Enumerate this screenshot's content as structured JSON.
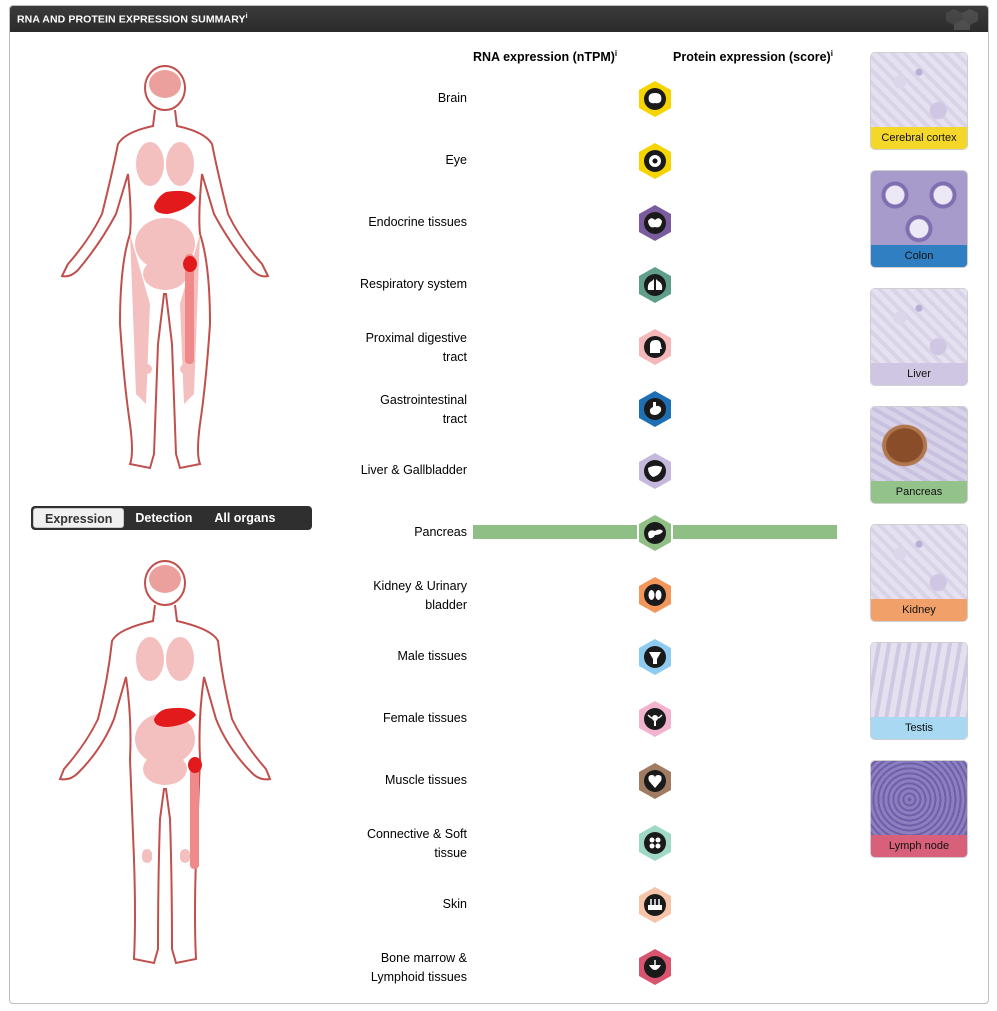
{
  "header": {
    "title": "RNA AND PROTEIN EXPRESSION SUMMARY",
    "info_mark": "i"
  },
  "columns": {
    "rna": "RNA expression (nTPM)",
    "protein": "Protein expression (score)",
    "info_mark": "i"
  },
  "toggle": {
    "items": [
      "Expression",
      "Detection",
      "All organs"
    ],
    "selected": "Expression"
  },
  "tissues": [
    {
      "label": "Brain",
      "color": "#f5d400",
      "icon": "brain-icon"
    },
    {
      "label": "Eye",
      "color": "#f5d400",
      "icon": "eye-icon"
    },
    {
      "label": "Endocrine tissues",
      "color": "#7a5c9e",
      "icon": "thyroid-icon"
    },
    {
      "label": "Respiratory system",
      "color": "#5f9e8a",
      "icon": "lungs-icon"
    },
    {
      "label": "Proximal digestive tract",
      "color": "#f4b8b8",
      "icon": "head-icon"
    },
    {
      "label": "Gastrointestinal tract",
      "color": "#1f6fb5",
      "icon": "stomach-icon"
    },
    {
      "label": "Liver & Gallbladder",
      "color": "#c5b8dc",
      "icon": "liver-icon"
    },
    {
      "label": "Pancreas",
      "color": "#8fbf85",
      "icon": "pancreas-icon"
    },
    {
      "label": "Kidney & Urinary bladder",
      "color": "#f2965a",
      "icon": "kidney-icon"
    },
    {
      "label": "Male tissues",
      "color": "#8ecbf0",
      "icon": "male-icon"
    },
    {
      "label": "Female tissues",
      "color": "#f2b3cf",
      "icon": "female-icon"
    },
    {
      "label": "Muscle tissues",
      "color": "#a07d62",
      "icon": "heart-icon"
    },
    {
      "label": "Connective & Soft tissue",
      "color": "#9fd9c6",
      "icon": "cells-icon"
    },
    {
      "label": "Skin",
      "color": "#f6c4a8",
      "icon": "skin-icon"
    },
    {
      "label": "Bone marrow & Lymphoid tissues",
      "color": "#d9546e",
      "icon": "lymph-icon"
    }
  ],
  "highlight": {
    "tissue": "Pancreas",
    "rna_level": 1.0,
    "protein_level": 1.0,
    "color": "#8fbf85"
  },
  "thumbnails": [
    {
      "label": "Cerebral cortex",
      "color": "#f5d72a"
    },
    {
      "label": "Colon",
      "color": "#2f7fc2"
    },
    {
      "label": "Liver",
      "color": "#cfc6e3"
    },
    {
      "label": "Pancreas",
      "color": "#93c28a"
    },
    {
      "label": "Kidney",
      "color": "#f2a06a"
    },
    {
      "label": "Testis",
      "color": "#a9d8f3"
    },
    {
      "label": "Lymph node",
      "color": "#d9607a"
    }
  ]
}
